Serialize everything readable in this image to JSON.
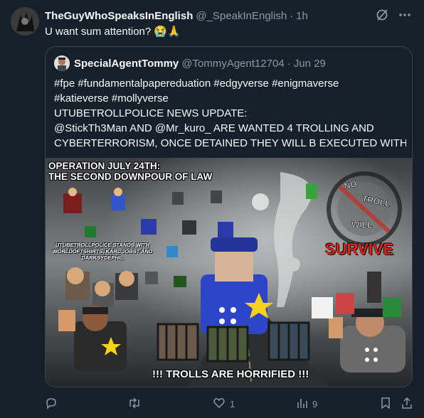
{
  "tweet": {
    "author_name": "TheGuyWhoSpeaksInEnglish",
    "author_handle": "@_SpeakInEnglish",
    "time": "1h",
    "text": "U want sum attention? 😭🙏"
  },
  "quote": {
    "author_name": "SpecialAgentTommy",
    "author_handle": "@TommyAgent12704",
    "date": "Jun 29",
    "lines": [
      "#fpe #fundamentalpapereduation #edgyverse #enigmaverse",
      "#katieverse #mollyverse",
      "UTUBETROLLPOLICE NEWS UPDATE:",
      "@StickTh3Man AND @Mr_kuro_ ARE WANTED 4 TROLLING AND",
      "CYBERTERRORISM, ONCE DETAINED THEY WILL B EXECUTED WITH ..."
    ],
    "media": {
      "title_line1": "OPERATION JULY 24TH:",
      "title_line2": "THE SECOND DOWNPOUR OF LAW",
      "caption": "UTUBETROLLPOLICE STANDS WITH WORLDOFTSHIRTS, KARL JOBST AND DARKSYDEPHIL",
      "sign_no": "NO",
      "sign_troll": "TROLL",
      "sign_will": "WILL",
      "survive": "SURVIVE",
      "bottom_text": "!!! TROLLS ARE HORRIFIED !!!"
    }
  },
  "actions": {
    "reply_count": "",
    "retweet_count": "",
    "like_count": "1",
    "views_count": "9"
  },
  "colors": {
    "background": "#15202b",
    "text": "#f7f9f9",
    "muted": "#8b98a5",
    "border": "#38444d",
    "survive_red": "#e0231b"
  },
  "icons": [
    "grok-icon",
    "more-icon",
    "reply-icon",
    "retweet-icon",
    "like-icon",
    "views-icon",
    "bookmark-icon",
    "share-icon"
  ]
}
